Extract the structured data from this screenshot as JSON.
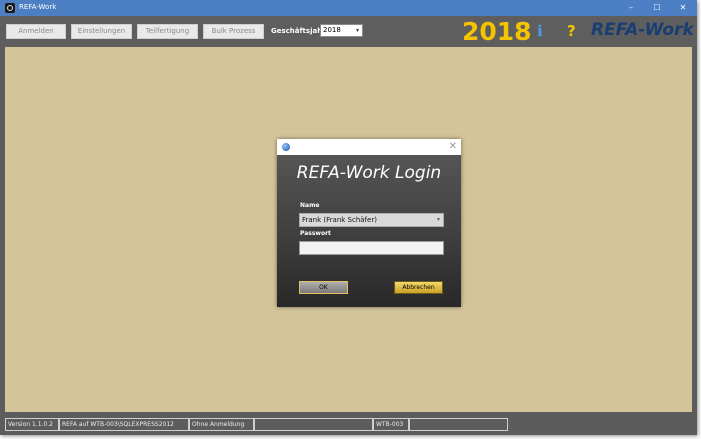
{
  "window": {
    "title": "REFA-Work",
    "minimize": "–",
    "maximize": "☐",
    "close": "✕"
  },
  "toolbar": {
    "buttons": [
      "Anmelden",
      "Einstellungen",
      "Teilfertigung",
      "Bulk Prozess"
    ],
    "fiscal_year_label": "Geschäftsjahr",
    "fiscal_year_value": "2018",
    "year_display": "2018",
    "info_icon": "i",
    "help_icon": "?",
    "brand": "REFA-Work"
  },
  "dialog": {
    "title": "",
    "heading": "REFA-Work Login",
    "name_label": "Name",
    "name_value": "Frank (Frank Schäfer)",
    "password_label": "Passwort",
    "password_value": "",
    "ok_label": "OK",
    "cancel_label": "Abbrechen",
    "close": "✕"
  },
  "statusbar": {
    "version": "Version 1.1.0.2",
    "server": "REFA auf WTB-003\\SQLEXPRESS2012",
    "login_status": "Ohne Anmeldung",
    "empty_1": "",
    "machine": "WTB-003",
    "empty_2": ""
  },
  "colors": {
    "titlebar": "#4d7fc4",
    "toolbar": "#5e5e5e",
    "workspace": "#d3c599",
    "year_accent": "#f5c400",
    "brand": "#1a3d73",
    "info": "#4a9be8"
  },
  "icons": {
    "app": "refa-app-icon",
    "dialog": "globe-icon",
    "info": "info-icon",
    "help": "help-icon",
    "dropdown": "chevron-down-icon"
  }
}
